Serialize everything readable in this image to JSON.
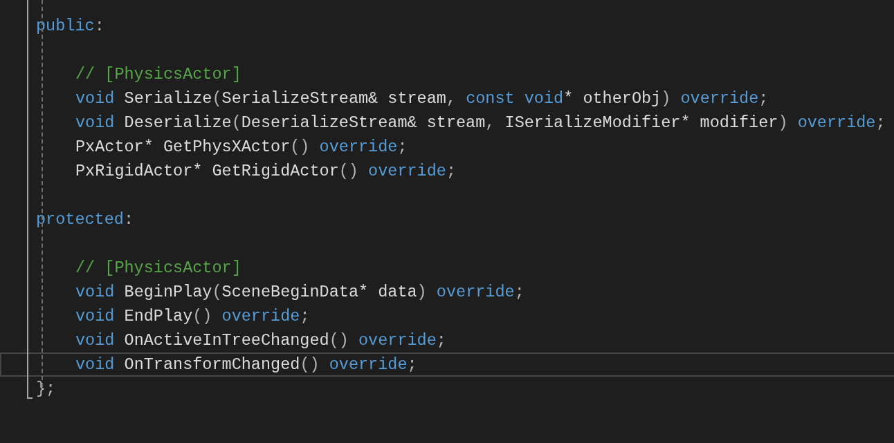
{
  "editor": {
    "lines": [
      {
        "kind": "outer",
        "current": false,
        "tokens": [
          {
            "kind": "keyword",
            "text": "public"
          },
          {
            "kind": "punct",
            "text": ":"
          }
        ]
      },
      {
        "kind": "blank",
        "current": false
      },
      {
        "kind": "inner",
        "current": false,
        "tokens": [
          {
            "kind": "comment",
            "text": "// [PhysicsActor]"
          }
        ]
      },
      {
        "kind": "inner",
        "current": false,
        "tokens": [
          {
            "kind": "keyword",
            "text": "void"
          },
          {
            "kind": "ident",
            "text": " Serialize"
          },
          {
            "kind": "punct",
            "text": "("
          },
          {
            "kind": "ident",
            "text": "SerializeStream& stream"
          },
          {
            "kind": "punct",
            "text": ", "
          },
          {
            "kind": "keyword",
            "text": "const void"
          },
          {
            "kind": "ident",
            "text": "* otherObj"
          },
          {
            "kind": "punct",
            "text": ") "
          },
          {
            "kind": "keyword",
            "text": "override"
          },
          {
            "kind": "punct",
            "text": ";"
          }
        ]
      },
      {
        "kind": "inner",
        "current": false,
        "tokens": [
          {
            "kind": "keyword",
            "text": "void"
          },
          {
            "kind": "ident",
            "text": " Deserialize"
          },
          {
            "kind": "punct",
            "text": "("
          },
          {
            "kind": "ident",
            "text": "DeserializeStream& stream"
          },
          {
            "kind": "punct",
            "text": ", "
          },
          {
            "kind": "ident",
            "text": "ISerializeModifier* modifier"
          },
          {
            "kind": "punct",
            "text": ") "
          },
          {
            "kind": "keyword",
            "text": "override"
          },
          {
            "kind": "punct",
            "text": ";"
          }
        ]
      },
      {
        "kind": "inner",
        "current": false,
        "tokens": [
          {
            "kind": "ident",
            "text": "PxActor* GetPhysXActor"
          },
          {
            "kind": "punct",
            "text": "() "
          },
          {
            "kind": "keyword",
            "text": "override"
          },
          {
            "kind": "punct",
            "text": ";"
          }
        ]
      },
      {
        "kind": "inner",
        "current": false,
        "tokens": [
          {
            "kind": "ident",
            "text": "PxRigidActor* GetRigidActor"
          },
          {
            "kind": "punct",
            "text": "() "
          },
          {
            "kind": "keyword",
            "text": "override"
          },
          {
            "kind": "punct",
            "text": ";"
          }
        ]
      },
      {
        "kind": "blank",
        "current": false
      },
      {
        "kind": "outer",
        "current": false,
        "tokens": [
          {
            "kind": "keyword",
            "text": "protected"
          },
          {
            "kind": "punct",
            "text": ":"
          }
        ]
      },
      {
        "kind": "blank",
        "current": false
      },
      {
        "kind": "inner",
        "current": false,
        "tokens": [
          {
            "kind": "comment",
            "text": "// [PhysicsActor]"
          }
        ]
      },
      {
        "kind": "inner",
        "current": false,
        "tokens": [
          {
            "kind": "keyword",
            "text": "void"
          },
          {
            "kind": "ident",
            "text": " BeginPlay"
          },
          {
            "kind": "punct",
            "text": "("
          },
          {
            "kind": "ident",
            "text": "SceneBeginData* data"
          },
          {
            "kind": "punct",
            "text": ") "
          },
          {
            "kind": "keyword",
            "text": "override"
          },
          {
            "kind": "punct",
            "text": ";"
          }
        ]
      },
      {
        "kind": "inner",
        "current": false,
        "tokens": [
          {
            "kind": "keyword",
            "text": "void"
          },
          {
            "kind": "ident",
            "text": " EndPlay"
          },
          {
            "kind": "punct",
            "text": "() "
          },
          {
            "kind": "keyword",
            "text": "override"
          },
          {
            "kind": "punct",
            "text": ";"
          }
        ]
      },
      {
        "kind": "inner",
        "current": false,
        "tokens": [
          {
            "kind": "keyword",
            "text": "void"
          },
          {
            "kind": "ident",
            "text": " OnActiveInTreeChanged"
          },
          {
            "kind": "punct",
            "text": "() "
          },
          {
            "kind": "keyword",
            "text": "override"
          },
          {
            "kind": "punct",
            "text": ";"
          }
        ]
      },
      {
        "kind": "inner",
        "current": true,
        "tokens": [
          {
            "kind": "keyword",
            "text": "void"
          },
          {
            "kind": "ident",
            "text": " OnTransformChanged"
          },
          {
            "kind": "punct",
            "text": "() "
          },
          {
            "kind": "keyword",
            "text": "override"
          },
          {
            "kind": "punct",
            "text": ";"
          }
        ]
      },
      {
        "kind": "outer",
        "current": false,
        "tokens": [
          {
            "kind": "punct",
            "text": "};"
          }
        ]
      }
    ]
  }
}
